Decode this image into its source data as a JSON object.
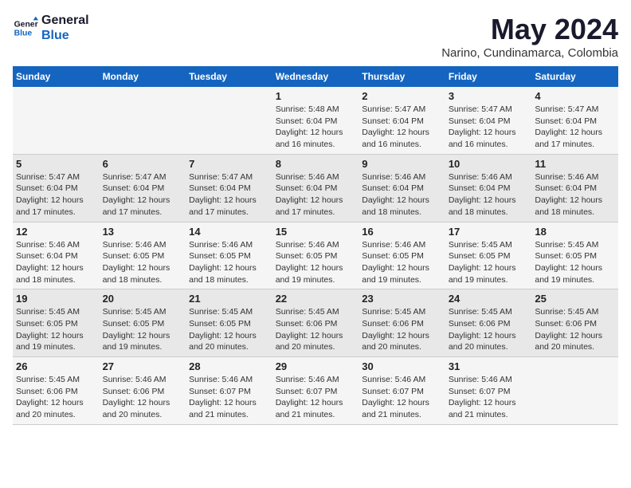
{
  "logo": {
    "line1": "General",
    "line2": "Blue"
  },
  "title": "May 2024",
  "subtitle": "Narino, Cundinamarca, Colombia",
  "weekdays": [
    "Sunday",
    "Monday",
    "Tuesday",
    "Wednesday",
    "Thursday",
    "Friday",
    "Saturday"
  ],
  "weeks": [
    [
      {
        "day": "",
        "sunrise": "",
        "sunset": "",
        "daylight": ""
      },
      {
        "day": "",
        "sunrise": "",
        "sunset": "",
        "daylight": ""
      },
      {
        "day": "",
        "sunrise": "",
        "sunset": "",
        "daylight": ""
      },
      {
        "day": "1",
        "sunrise": "Sunrise: 5:48 AM",
        "sunset": "Sunset: 6:04 PM",
        "daylight": "Daylight: 12 hours and 16 minutes."
      },
      {
        "day": "2",
        "sunrise": "Sunrise: 5:47 AM",
        "sunset": "Sunset: 6:04 PM",
        "daylight": "Daylight: 12 hours and 16 minutes."
      },
      {
        "day": "3",
        "sunrise": "Sunrise: 5:47 AM",
        "sunset": "Sunset: 6:04 PM",
        "daylight": "Daylight: 12 hours and 16 minutes."
      },
      {
        "day": "4",
        "sunrise": "Sunrise: 5:47 AM",
        "sunset": "Sunset: 6:04 PM",
        "daylight": "Daylight: 12 hours and 17 minutes."
      }
    ],
    [
      {
        "day": "5",
        "sunrise": "Sunrise: 5:47 AM",
        "sunset": "Sunset: 6:04 PM",
        "daylight": "Daylight: 12 hours and 17 minutes."
      },
      {
        "day": "6",
        "sunrise": "Sunrise: 5:47 AM",
        "sunset": "Sunset: 6:04 PM",
        "daylight": "Daylight: 12 hours and 17 minutes."
      },
      {
        "day": "7",
        "sunrise": "Sunrise: 5:47 AM",
        "sunset": "Sunset: 6:04 PM",
        "daylight": "Daylight: 12 hours and 17 minutes."
      },
      {
        "day": "8",
        "sunrise": "Sunrise: 5:46 AM",
        "sunset": "Sunset: 6:04 PM",
        "daylight": "Daylight: 12 hours and 17 minutes."
      },
      {
        "day": "9",
        "sunrise": "Sunrise: 5:46 AM",
        "sunset": "Sunset: 6:04 PM",
        "daylight": "Daylight: 12 hours and 18 minutes."
      },
      {
        "day": "10",
        "sunrise": "Sunrise: 5:46 AM",
        "sunset": "Sunset: 6:04 PM",
        "daylight": "Daylight: 12 hours and 18 minutes."
      },
      {
        "day": "11",
        "sunrise": "Sunrise: 5:46 AM",
        "sunset": "Sunset: 6:04 PM",
        "daylight": "Daylight: 12 hours and 18 minutes."
      }
    ],
    [
      {
        "day": "12",
        "sunrise": "Sunrise: 5:46 AM",
        "sunset": "Sunset: 6:04 PM",
        "daylight": "Daylight: 12 hours and 18 minutes."
      },
      {
        "day": "13",
        "sunrise": "Sunrise: 5:46 AM",
        "sunset": "Sunset: 6:05 PM",
        "daylight": "Daylight: 12 hours and 18 minutes."
      },
      {
        "day": "14",
        "sunrise": "Sunrise: 5:46 AM",
        "sunset": "Sunset: 6:05 PM",
        "daylight": "Daylight: 12 hours and 18 minutes."
      },
      {
        "day": "15",
        "sunrise": "Sunrise: 5:46 AM",
        "sunset": "Sunset: 6:05 PM",
        "daylight": "Daylight: 12 hours and 19 minutes."
      },
      {
        "day": "16",
        "sunrise": "Sunrise: 5:46 AM",
        "sunset": "Sunset: 6:05 PM",
        "daylight": "Daylight: 12 hours and 19 minutes."
      },
      {
        "day": "17",
        "sunrise": "Sunrise: 5:45 AM",
        "sunset": "Sunset: 6:05 PM",
        "daylight": "Daylight: 12 hours and 19 minutes."
      },
      {
        "day": "18",
        "sunrise": "Sunrise: 5:45 AM",
        "sunset": "Sunset: 6:05 PM",
        "daylight": "Daylight: 12 hours and 19 minutes."
      }
    ],
    [
      {
        "day": "19",
        "sunrise": "Sunrise: 5:45 AM",
        "sunset": "Sunset: 6:05 PM",
        "daylight": "Daylight: 12 hours and 19 minutes."
      },
      {
        "day": "20",
        "sunrise": "Sunrise: 5:45 AM",
        "sunset": "Sunset: 6:05 PM",
        "daylight": "Daylight: 12 hours and 19 minutes."
      },
      {
        "day": "21",
        "sunrise": "Sunrise: 5:45 AM",
        "sunset": "Sunset: 6:05 PM",
        "daylight": "Daylight: 12 hours and 20 minutes."
      },
      {
        "day": "22",
        "sunrise": "Sunrise: 5:45 AM",
        "sunset": "Sunset: 6:06 PM",
        "daylight": "Daylight: 12 hours and 20 minutes."
      },
      {
        "day": "23",
        "sunrise": "Sunrise: 5:45 AM",
        "sunset": "Sunset: 6:06 PM",
        "daylight": "Daylight: 12 hours and 20 minutes."
      },
      {
        "day": "24",
        "sunrise": "Sunrise: 5:45 AM",
        "sunset": "Sunset: 6:06 PM",
        "daylight": "Daylight: 12 hours and 20 minutes."
      },
      {
        "day": "25",
        "sunrise": "Sunrise: 5:45 AM",
        "sunset": "Sunset: 6:06 PM",
        "daylight": "Daylight: 12 hours and 20 minutes."
      }
    ],
    [
      {
        "day": "26",
        "sunrise": "Sunrise: 5:45 AM",
        "sunset": "Sunset: 6:06 PM",
        "daylight": "Daylight: 12 hours and 20 minutes."
      },
      {
        "day": "27",
        "sunrise": "Sunrise: 5:46 AM",
        "sunset": "Sunset: 6:06 PM",
        "daylight": "Daylight: 12 hours and 20 minutes."
      },
      {
        "day": "28",
        "sunrise": "Sunrise: 5:46 AM",
        "sunset": "Sunset: 6:07 PM",
        "daylight": "Daylight: 12 hours and 21 minutes."
      },
      {
        "day": "29",
        "sunrise": "Sunrise: 5:46 AM",
        "sunset": "Sunset: 6:07 PM",
        "daylight": "Daylight: 12 hours and 21 minutes."
      },
      {
        "day": "30",
        "sunrise": "Sunrise: 5:46 AM",
        "sunset": "Sunset: 6:07 PM",
        "daylight": "Daylight: 12 hours and 21 minutes."
      },
      {
        "day": "31",
        "sunrise": "Sunrise: 5:46 AM",
        "sunset": "Sunset: 6:07 PM",
        "daylight": "Daylight: 12 hours and 21 minutes."
      },
      {
        "day": "",
        "sunrise": "",
        "sunset": "",
        "daylight": ""
      }
    ]
  ]
}
